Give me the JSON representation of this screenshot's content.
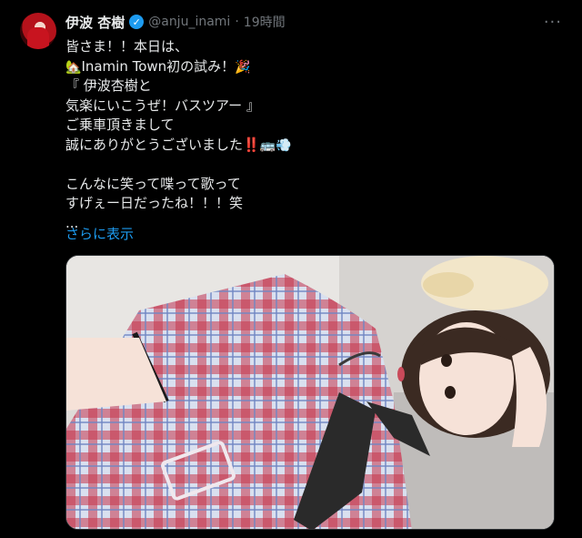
{
  "tweet": {
    "display_name": "伊波 杏樹",
    "verified_glyph": "✓",
    "handle": "@anju_inami",
    "dot": "·",
    "time": "19時間",
    "more_glyph": "···",
    "lines": [
      "皆さま！！本日は、",
      "Inamin Town初の試み！",
      "『 伊波杏樹と",
      "気楽にいこうぜ！バスツアー 』",
      "ご乗車頂きまして",
      "誠にありがとうございました‼️",
      "",
      "こんなに笑って喋って歌って",
      "すげぇー日だったね！！！笑",
      "..."
    ],
    "show_more": "さらに表示"
  },
  "icons": {
    "house": "house-with-garden-emoji",
    "party": "party-popper-emoji",
    "bus": "bus-emoji",
    "dash": "dash-emoji"
  },
  "colors": {
    "background": "#000000",
    "text": "#e7e9ea",
    "secondary": "#71767b",
    "link": "#1d9bf0",
    "verified": "#1d9bf0"
  }
}
